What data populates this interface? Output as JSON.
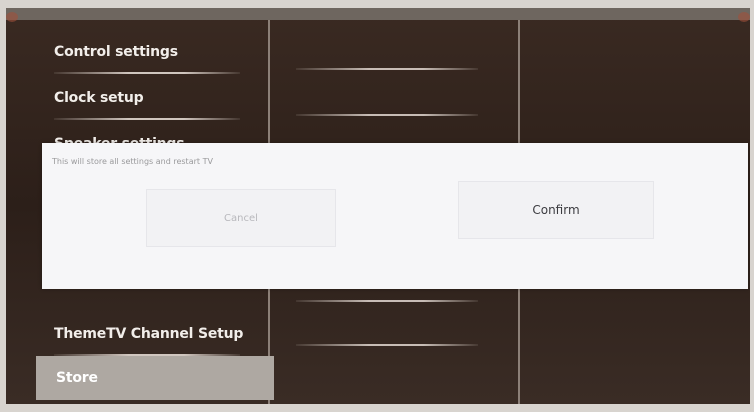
{
  "menu": {
    "items": [
      {
        "label": "Control settings"
      },
      {
        "label": "Clock setup"
      },
      {
        "label": "Speaker settings"
      },
      {
        "label": "ThemeTV Channel Setup"
      },
      {
        "label": "Store"
      }
    ],
    "selected": "Store"
  },
  "dialog": {
    "message": "This will store all settings and restart TV",
    "cancel_label": "Cancel",
    "confirm_label": "Confirm"
  },
  "colors": {
    "background": "#2c1f19",
    "selected_item": "#aea8a2",
    "dialog": "#f6f6f8"
  }
}
